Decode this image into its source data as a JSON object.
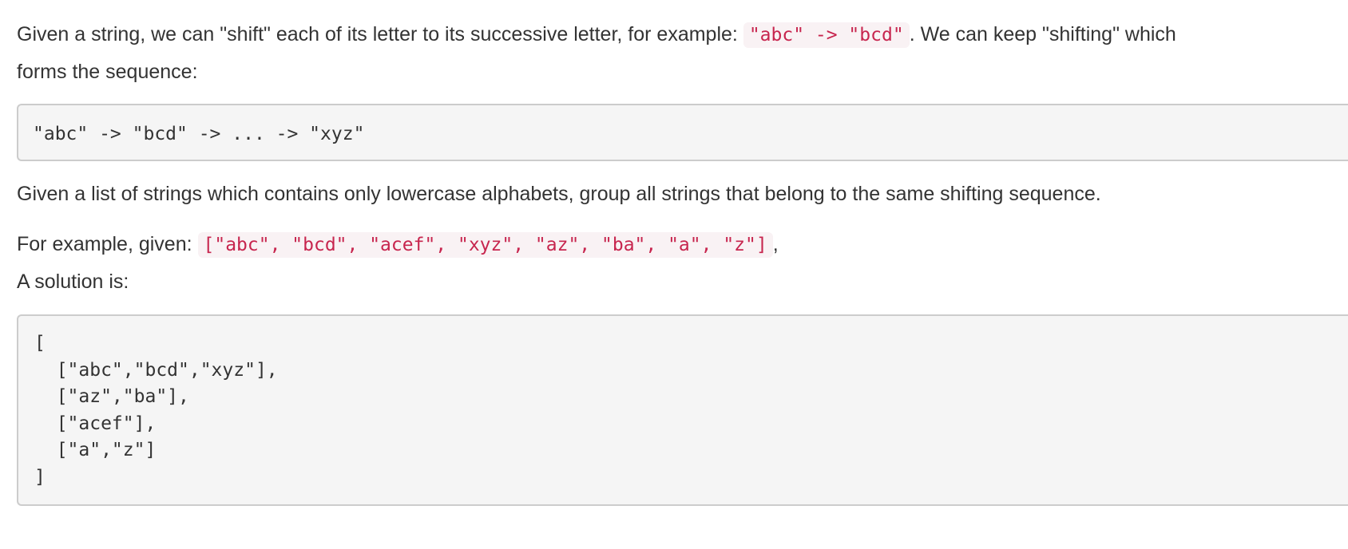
{
  "intro": {
    "text_before": "Given a string, we can \"shift\" each of its letter to its successive letter, for example: ",
    "code": "\"abc\" -> \"bcd\"",
    "text_after": ". We can keep \"shifting\" which",
    "line2": "forms the sequence:"
  },
  "sequence_block": "\"abc\" -> \"bcd\" -> ... -> \"xyz\"",
  "task": "Given a list of strings which contains only lowercase alphabets, group all strings that belong to the same shifting sequence.",
  "example": {
    "label": "For example, given: ",
    "code": "[\"abc\", \"bcd\", \"acef\", \"xyz\", \"az\", \"ba\", \"a\", \"z\"]",
    "suffix": ","
  },
  "solution_label": "A solution is:",
  "solution_block": "[\n  [\"abc\",\"bcd\",\"xyz\"],\n  [\"az\",\"ba\"],\n  [\"acef\"],\n  [\"a\",\"z\"]\n]",
  "colors": {
    "text": "#333333",
    "inline_code_text": "#c7254e",
    "inline_code_bg": "#f9f2f4",
    "block_bg": "#f5f5f5",
    "block_border": "#cccccc"
  }
}
